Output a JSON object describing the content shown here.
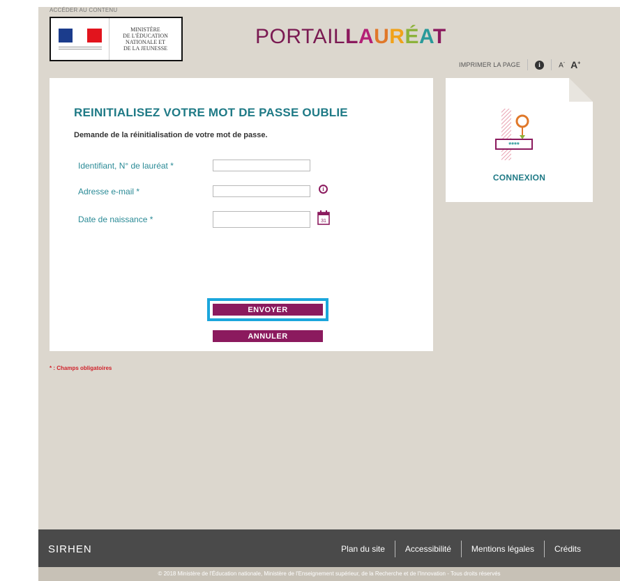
{
  "header": {
    "skip_link": "ACCÉDER AU CONTENU",
    "logo_lines": [
      "MINISTÈRE",
      "DE L'ÉDUCATION",
      "NATIONALE ET",
      "DE LA JEUNESSE"
    ],
    "brand_light": "PORTAIL",
    "brand_bold": [
      "L",
      "A",
      "U",
      "R",
      "É",
      "A",
      "T"
    ],
    "print_label": "IMPRIMER LA PAGE",
    "info_icon_glyph": "i",
    "font_decrease": "A",
    "font_increase": "A"
  },
  "form": {
    "title": "REINITIALISEZ VOTRE MOT DE PASSE OUBLIE",
    "subtitle": "Demande de la réinitialisation de votre mot de passe.",
    "fields": [
      {
        "label": "Identifiant, N° de lauréat *",
        "value": ""
      },
      {
        "label": "Adresse e-mail *",
        "value": ""
      },
      {
        "label": "Date de naissance *",
        "value": ""
      }
    ],
    "calendar_day": "31",
    "send_label": "ENVOYER",
    "cancel_label": "ANNULER",
    "required_note": "* : Champs obligatoires"
  },
  "side": {
    "login_label": "CONNEXION",
    "password_stars": "****"
  },
  "footer": {
    "brand": "SIRHEN",
    "links": [
      "Plan du site",
      "Accessibilité",
      "Mentions légales",
      "Crédits"
    ],
    "copyright": "© 2018 Ministère de l'Éducation nationale, Ministère de l'Enseignement supérieur, de la Recherche et de l'Innovation - Tous droits réservés"
  },
  "colors": {
    "accent": "#8b1a5e",
    "title_teal": "#1f7a86",
    "highlight": "#1ba6dc",
    "page_bg": "#dcd7ce",
    "footer_bg": "#4a4a4a"
  }
}
